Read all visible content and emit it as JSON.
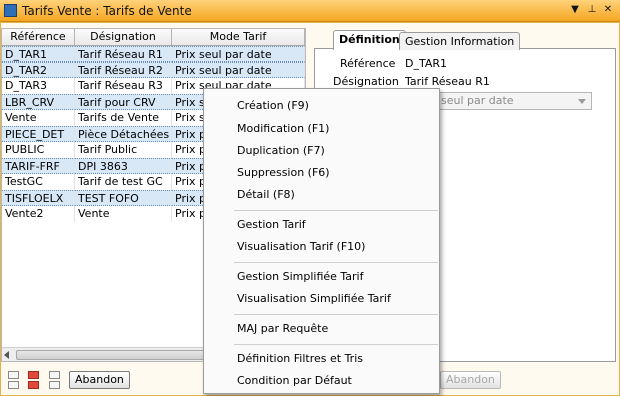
{
  "window": {
    "title": "Tarifs Vente : Tarifs de Vente",
    "pin_glyph": "▼",
    "dock_glyph": "⊥",
    "close_glyph": "✕"
  },
  "grid": {
    "columns": [
      "Référence",
      "Désignation",
      "Mode Tarif"
    ],
    "rows": [
      {
        "ref": "D_TAR1",
        "des": "Tarif Réseau R1",
        "mode": "Prix seul par date"
      },
      {
        "ref": "D_TAR2",
        "des": "Tarif Réseau R2",
        "mode": "Prix seul par date"
      },
      {
        "ref": "D_TAR3",
        "des": "Tarif Réseau R3",
        "mode": "Prix seul par date"
      },
      {
        "ref": "LBR_CRV",
        "des": "Tarif pour CRV",
        "mode": "Prix se"
      },
      {
        "ref": "Vente",
        "des": "Tarifs de Vente",
        "mode": "Prix se"
      },
      {
        "ref": "PIECE_DET",
        "des": "Pièce Détachées",
        "mode": "Prix pa"
      },
      {
        "ref": "PUBLIC",
        "des": "Tarif Public",
        "mode": "Prix pa"
      },
      {
        "ref": "TARIF-FRF",
        "des": "DPI 3863",
        "mode": "Prix pa"
      },
      {
        "ref": "TestGC",
        "des": "Tarif de test GC",
        "mode": "Prix pa"
      },
      {
        "ref": "TISFLOELX",
        "des": "TEST FOFO",
        "mode": "Prix pa"
      },
      {
        "ref": "Vente2",
        "des": "Vente",
        "mode": "Prix pa"
      }
    ]
  },
  "buttons": {
    "abandon_left": "Abandon",
    "abandon_right": "Abandon"
  },
  "tabs": [
    {
      "label": "Définition"
    },
    {
      "label": "Gestion Information"
    }
  ],
  "detail": {
    "ref_label": "Référence",
    "ref_value": "D_TAR1",
    "des_label": "Désignation",
    "des_value": "Tarif Réseau R1",
    "mode_value": "seul par date"
  },
  "context_menu": {
    "items": [
      "Création (F9)",
      "Modification (F1)",
      "Duplication (F7)",
      "Suppression (F6)",
      "Détail (F8)",
      "Gestion Tarif",
      "Visualisation Tarif (F10)",
      "Gestion Simplifiée Tarif",
      "Visualisation Simplifiée Tarif",
      "MAJ par Requête",
      "Définition Filtres et Tris",
      "Condition par Défaut"
    ]
  },
  "colors": {
    "accent": "#f5a623",
    "selection": "#d8e8f7"
  }
}
